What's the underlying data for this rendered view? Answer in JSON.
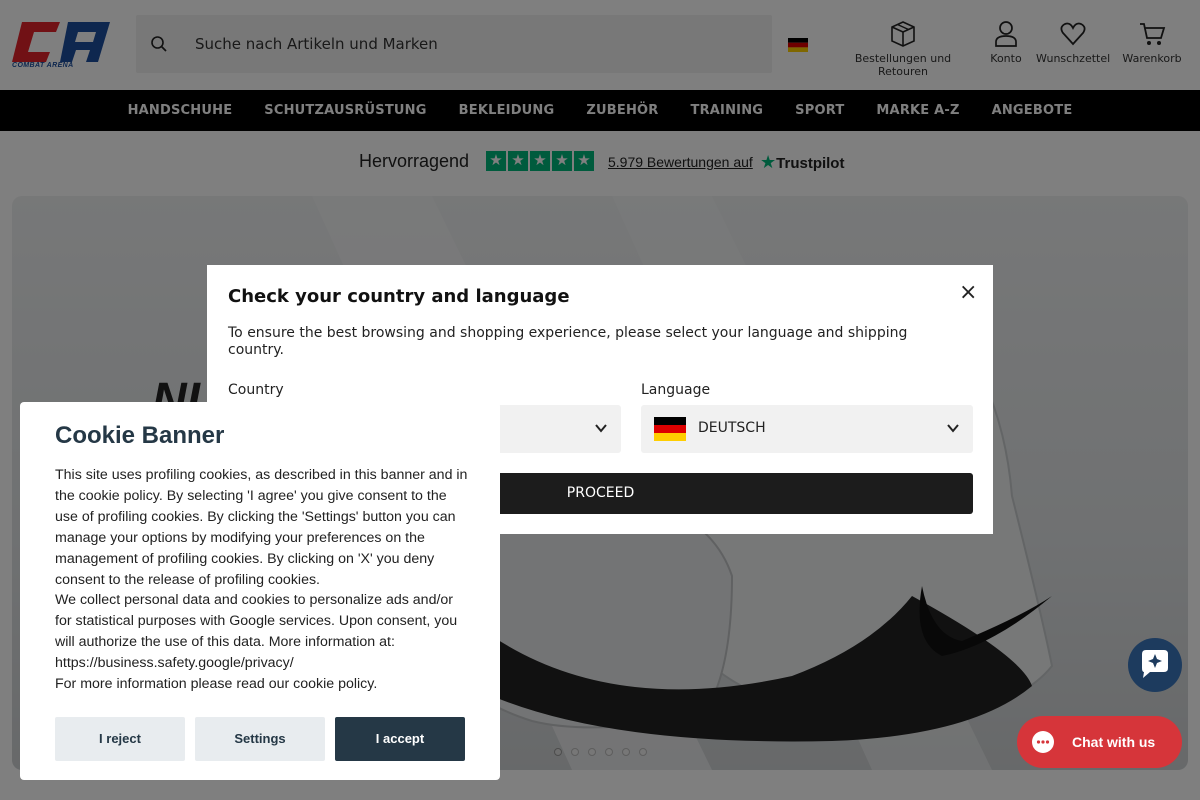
{
  "header": {
    "logo_text": "COMBAT ARENA",
    "search_placeholder": "Suche nach Artikeln und Marken",
    "orders_label": "Bestellungen und Retouren",
    "account_label": "Konto",
    "wishlist_label": "Wunschzettel",
    "cart_label": "Warenkorb"
  },
  "nav": {
    "items": [
      "HANDSCHUHE",
      "SCHUTZAUSRÜSTUNG",
      "BEKLEIDUNG",
      "ZUBEHÖR",
      "TRAINING",
      "SPORT",
      "MARKE A-Z",
      "ANGEBOTE"
    ]
  },
  "trustpilot": {
    "rating_label": "Hervorragend",
    "stars": 5,
    "reviews_text": "5.979 Bewertungen auf",
    "brand": "Trustpilot"
  },
  "hero": {
    "slide_count": 6,
    "active_index": 0
  },
  "modal": {
    "title": "Check your country and language",
    "description": "To ensure the best browsing and shopping experience, please select your language and shipping country.",
    "country_label": "Country",
    "language_label": "Language",
    "language_value": "DEUTSCH",
    "proceed_label": "PROCEED",
    "close_icon": "×"
  },
  "cookie": {
    "title": "Cookie Banner",
    "text": "This site uses profiling cookies, as described in this banner and in the cookie policy. By selecting 'I agree' you give consent to the use of profiling cookies. By clicking the 'Settings' button you can manage your options by modifying your preferences on the management of profiling cookies. By clicking on 'X' you deny consent to the release of profiling cookies.",
    "text2": "We collect personal data and cookies to personalize ads and/or for statistical purposes with Google services. Upon consent, you will authorize the use of this data. More information at: https://business.safety.google/privacy/",
    "text3": "For more information please read our cookie policy.",
    "reject_label": "I reject",
    "settings_label": "Settings",
    "accept_label": "I accept"
  },
  "chat": {
    "label": "Chat with us"
  },
  "colors": {
    "logo_red": "#e3222b",
    "logo_blue": "#1d4f9e",
    "trustpilot_green": "#00b67a",
    "cookie_dark": "#253846",
    "chat_red": "#d6353a",
    "chat_navy": "#1d3b5e"
  }
}
